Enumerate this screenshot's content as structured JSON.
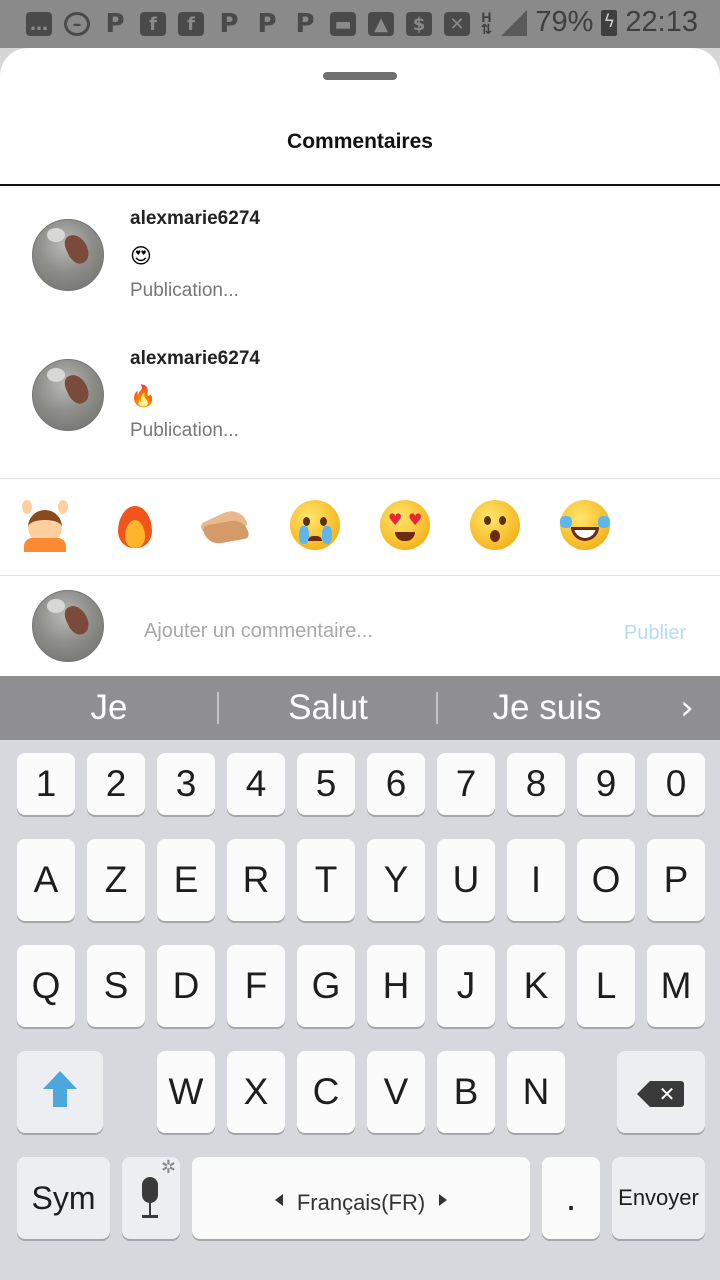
{
  "status_bar": {
    "notification_icons": [
      "chat-icon",
      "dnd-icon",
      "pinterest-icon",
      "facebook-icon",
      "facebook-icon",
      "pinterest-icon",
      "pinterest-icon",
      "pinterest-icon",
      "message-icon",
      "image-icon",
      "money-icon",
      "mail-icon"
    ],
    "battery": "79%",
    "time": "22:13"
  },
  "sheet": {
    "title": "Commentaires"
  },
  "comments": [
    {
      "username": "alexmarie6274",
      "emoji": "😍",
      "meta": "Publication..."
    },
    {
      "username": "alexmarie6274",
      "emoji": "🔥",
      "meta": "Publication..."
    }
  ],
  "quick_reactions": [
    "raising-hands",
    "fire",
    "clapping-hands",
    "crying-face",
    "heart-eyes-face",
    "surprised-face",
    "laughing-tears-face"
  ],
  "composer": {
    "placeholder": "Ajouter un commentaire...",
    "publish_label": "Publier"
  },
  "keyboard": {
    "suggestions": [
      "Je",
      "Salut",
      "Je suis"
    ],
    "row_numbers": [
      "1",
      "2",
      "3",
      "4",
      "5",
      "6",
      "7",
      "8",
      "9",
      "0"
    ],
    "row_1": [
      "A",
      "Z",
      "E",
      "R",
      "T",
      "Y",
      "U",
      "I",
      "O",
      "P"
    ],
    "row_2": [
      "Q",
      "S",
      "D",
      "F",
      "G",
      "H",
      "J",
      "K",
      "L",
      "M"
    ],
    "row_3": [
      "W",
      "X",
      "C",
      "V",
      "B",
      "N"
    ],
    "sym_label": "Sym",
    "space_label": "Français(FR)",
    "period_label": ".",
    "send_label": "Envoyer"
  },
  "colors": {
    "publish_disabled": "#b5dcf7",
    "shift_accent": "#4ea6de",
    "suggestion_bar": "#8e8e93"
  }
}
